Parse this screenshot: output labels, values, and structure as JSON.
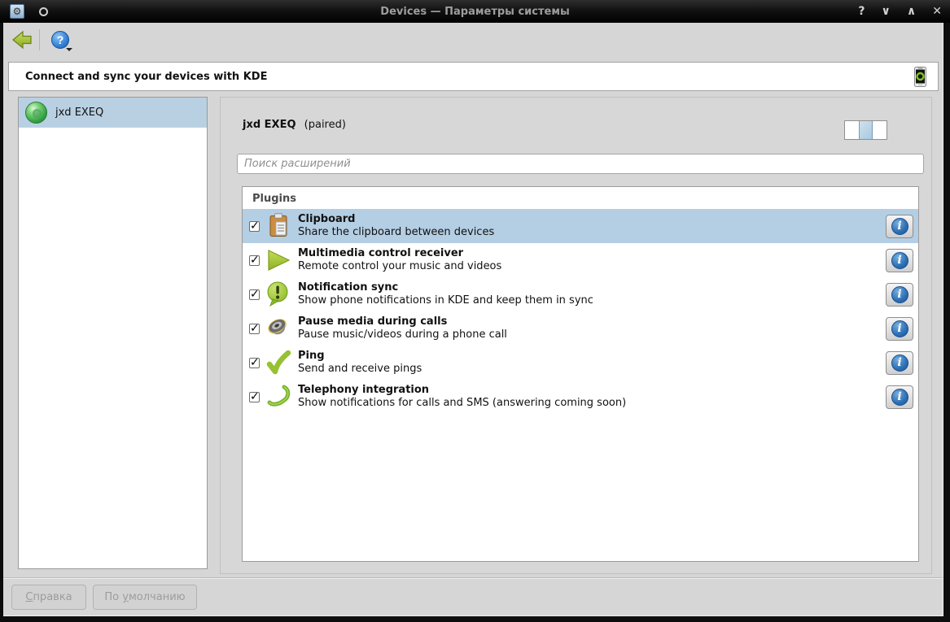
{
  "window": {
    "title": "Devices — Параметры системы",
    "app_icon": "⚙",
    "controls": {
      "help": "?",
      "minimize": "∨",
      "maximize": "∧",
      "close": "✕"
    }
  },
  "banner": {
    "text": "Connect and sync your devices with KDE",
    "icon": "smartphone-icon"
  },
  "sidebar": {
    "devices": [
      {
        "name": "jxd EXEQ",
        "icon": "green-sphere-icon",
        "selected": true
      }
    ]
  },
  "main": {
    "device_name": "jxd EXEQ",
    "device_status": "(paired)",
    "search_placeholder": "Поиск расширений",
    "plugins_title": "Plugins",
    "info_glyph": "i",
    "plugins": [
      {
        "name": "Clipboard",
        "description": "Share the clipboard between devices",
        "icon": "clipboard-icon",
        "checked": true,
        "selected": true
      },
      {
        "name": "Multimedia control receiver",
        "description": "Remote control your music and videos",
        "icon": "play-icon",
        "checked": true,
        "selected": false
      },
      {
        "name": "Notification sync",
        "description": "Show phone notifications in KDE and keep them in sync",
        "icon": "notification-bubble-icon",
        "checked": true,
        "selected": false
      },
      {
        "name": "Pause media during calls",
        "description": "Pause music/videos during a phone call",
        "icon": "speaker-icon",
        "checked": true,
        "selected": false
      },
      {
        "name": "Ping",
        "description": "Send and receive pings",
        "icon": "checkmark-icon",
        "checked": true,
        "selected": false
      },
      {
        "name": "Telephony integration",
        "description": "Show notifications for calls and SMS (answering coming soon)",
        "icon": "phone-handset-icon",
        "checked": true,
        "selected": false
      }
    ]
  },
  "footer": {
    "help_button": {
      "accel": "С",
      "rest": "правка"
    },
    "defaults_button": {
      "pre": "По ",
      "accel": "у",
      "rest": "молчанию"
    }
  },
  "colors": {
    "selection_blue": "#b4cee4",
    "accent_green": "#9bc32a",
    "info_blue": "#2d6fb5",
    "titlebar_text": "#9d9d9d"
  }
}
